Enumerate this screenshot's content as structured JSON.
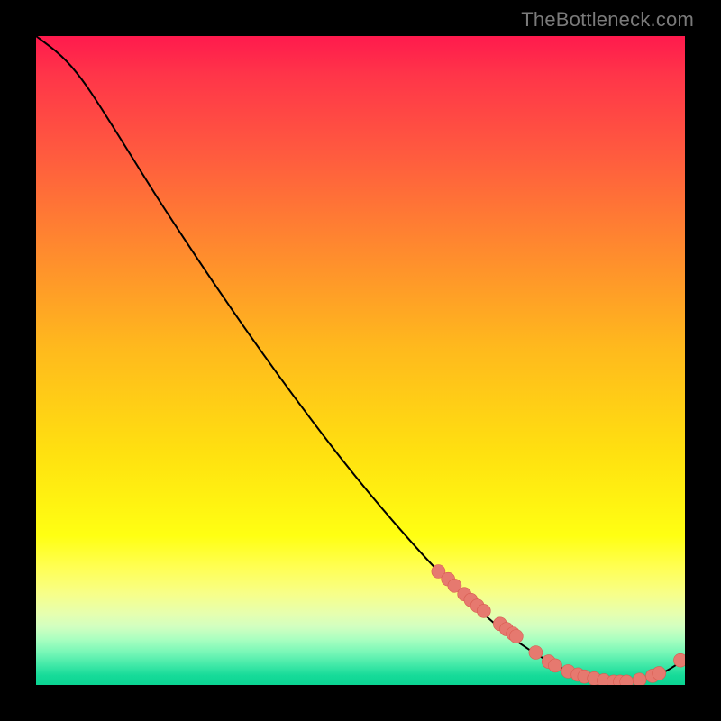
{
  "watermark": "TheBottleneck.com",
  "colors": {
    "point_fill": "#e6796f",
    "point_stroke": "#d85b50",
    "curve": "#000000"
  },
  "chart_data": {
    "type": "line",
    "title": "",
    "xlabel": "",
    "ylabel": "",
    "xlim": [
      0,
      100
    ],
    "ylim": [
      0,
      100
    ],
    "grid": false,
    "legend": false,
    "notes": "Axes are unlabeled; values estimated as percent of plot area. Curve descends from top-left to ~x=80, then sweeps up slightly near the right edge. Scatter points lie on the curve near the bottom-right.",
    "curve": {
      "x": [
        0,
        4,
        7,
        10,
        15,
        20,
        30,
        40,
        50,
        60,
        65,
        70,
        73,
        76,
        79,
        82,
        85,
        88,
        91,
        94,
        97,
        100
      ],
      "y": [
        100,
        97,
        93.5,
        89,
        81,
        73,
        58,
        44,
        31,
        19.5,
        14.5,
        10,
        7.5,
        5.4,
        3.6,
        2.1,
        1.2,
        0.6,
        0.4,
        0.8,
        2.0,
        4.0
      ]
    },
    "series": [
      {
        "name": "points",
        "type": "scatter",
        "x": [
          62,
          63.5,
          64.5,
          66,
          67,
          68,
          69,
          71.5,
          72.5,
          73.5,
          74,
          77,
          79,
          80,
          82,
          83.5,
          84.5,
          86,
          87.5,
          89,
          90,
          91,
          93,
          95,
          96,
          99.3
        ],
        "y": [
          17.5,
          16.3,
          15.3,
          14,
          13.1,
          12.2,
          11.4,
          9.4,
          8.6,
          7.9,
          7.5,
          5.0,
          3.6,
          3.0,
          2.1,
          1.6,
          1.3,
          1.0,
          0.7,
          0.5,
          0.5,
          0.5,
          0.8,
          1.4,
          1.8,
          3.8
        ]
      }
    ]
  }
}
